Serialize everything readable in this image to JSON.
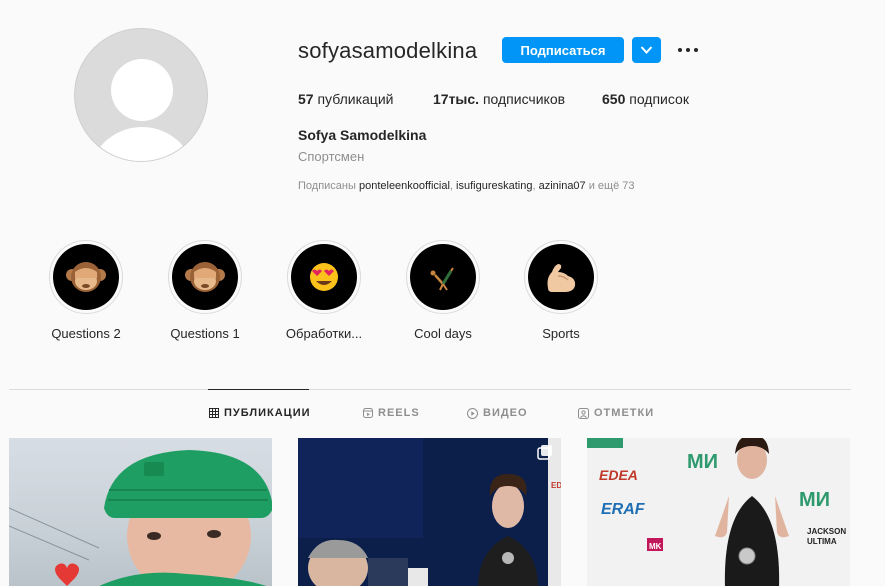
{
  "profile": {
    "username": "sofyasamodelkina",
    "follow_label": "Подписаться",
    "full_name": "Sofya Samodelkina",
    "category": "Спортсмен",
    "stats": {
      "posts_value": "57",
      "posts_label": " публикаций",
      "followers_value": "17тыс.",
      "followers_label": " подписчиков",
      "following_value": "650",
      "following_label": " подписок"
    },
    "followed_by": {
      "prefix": "Подписаны ",
      "accounts": [
        "ponteleenkoofficial",
        "isufigureskating",
        "azinina07"
      ],
      "separator": ", ",
      "suffix": " и ещё 73"
    }
  },
  "highlights": [
    {
      "label": "Questions 2",
      "icon": "see-no-evil-monkey-icon"
    },
    {
      "label": "Questions 1",
      "icon": "see-no-evil-monkey-icon"
    },
    {
      "label": "Обработки...",
      "icon": "heart-eyes-face-icon"
    },
    {
      "label": "Cool days",
      "icon": "cartwheel-person-icon"
    },
    {
      "label": "Sports",
      "icon": "flexed-biceps-icon"
    }
  ],
  "tabs": [
    {
      "label": "ПУБЛИКАЦИИ",
      "icon": "grid-icon",
      "active": true
    },
    {
      "label": "REELS",
      "icon": "reels-icon",
      "active": false
    },
    {
      "label": "ВИДЕО",
      "icon": "video-play-icon",
      "active": false
    },
    {
      "label": "ОТМЕТКИ",
      "icon": "tagged-icon",
      "active": false
    }
  ],
  "posts": [
    {
      "kind": "photo"
    },
    {
      "kind": "carousel"
    },
    {
      "kind": "photo"
    }
  ],
  "post_text": {
    "post3_brand1": "EDEA",
    "post3_brand2": "ERAF",
    "post3_brand3": "MK",
    "post3_brand4": "JACKSON",
    "post3_brand5": "ULTIMA",
    "post2_brand": "EDEA"
  },
  "colors": {
    "accent": "#0095f6",
    "text": "#262626",
    "muted": "#8e8e8e",
    "border": "#dbdbdb",
    "background": "#fafafa"
  }
}
